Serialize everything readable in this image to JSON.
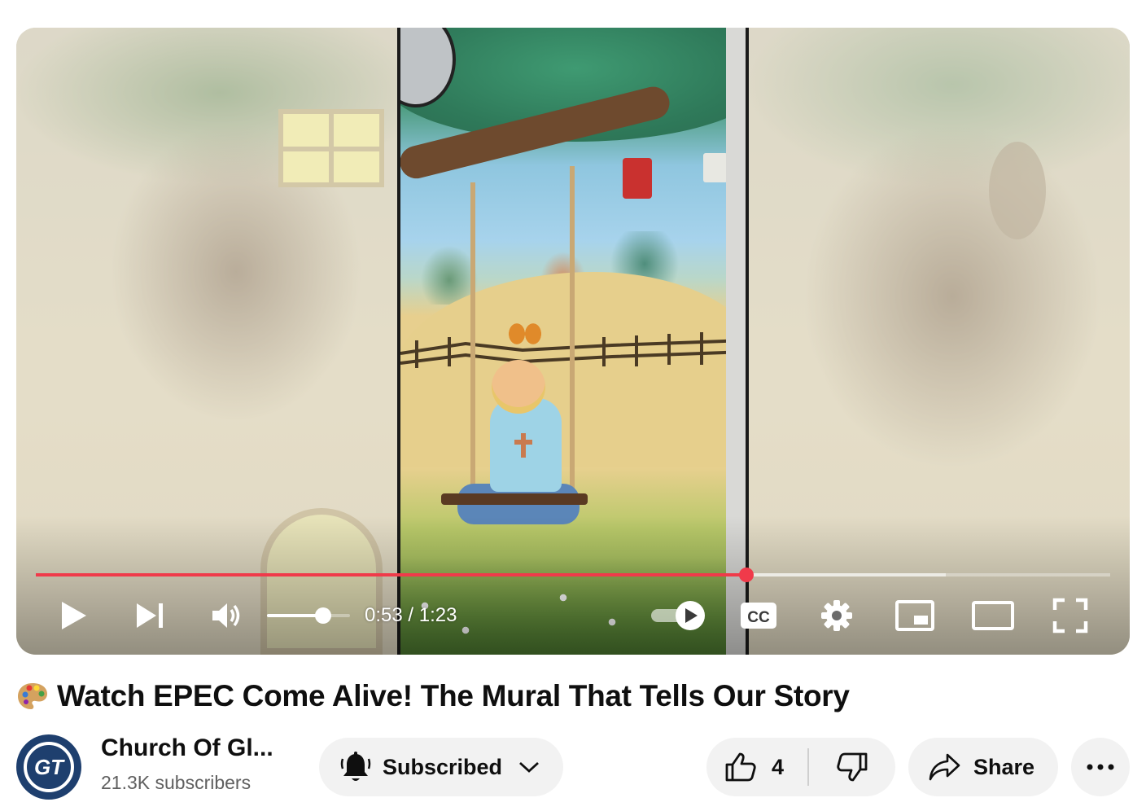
{
  "player": {
    "time_current": "0:53",
    "time_separator": " / ",
    "time_total": "1:23",
    "progress_played_fraction": 0.661,
    "progress_buffered_fraction": 0.847,
    "volume_fraction": 0.68,
    "accent_color": "#f03a4a",
    "controls": {
      "play_icon": "play-icon",
      "next_icon": "next-icon",
      "volume_icon": "volume-icon",
      "autoplay_icon": "autoplay-toggle-icon",
      "captions_label": "CC",
      "settings_icon": "gear-icon",
      "miniplayer_icon": "miniplayer-icon",
      "theater_icon": "theater-mode-icon",
      "fullscreen_icon": "fullscreen-icon"
    }
  },
  "video": {
    "title": "Watch EPEC Come Alive! The Mural That Tells Our Story",
    "title_icon": "artist-palette-icon"
  },
  "channel": {
    "name": "Church Of Gl...",
    "subscribers": "21.3K subscribers",
    "avatar_text": "GT"
  },
  "actions": {
    "subscribed_label": "Subscribed",
    "like_count": "4",
    "share_label": "Share"
  }
}
